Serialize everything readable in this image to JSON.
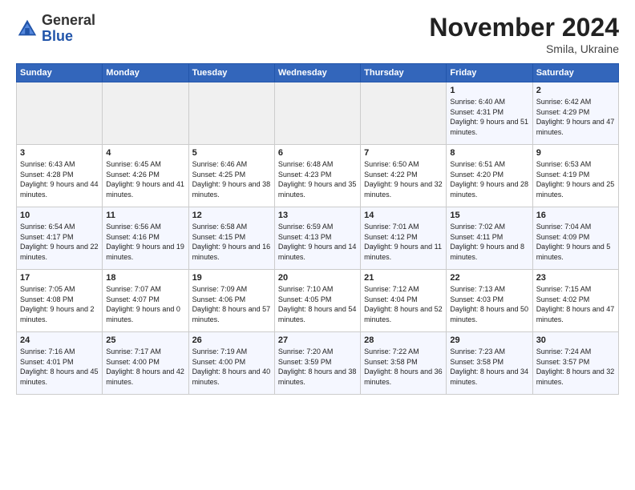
{
  "logo": {
    "general": "General",
    "blue": "Blue"
  },
  "header": {
    "title": "November 2024",
    "location": "Smila, Ukraine"
  },
  "days_of_week": [
    "Sunday",
    "Monday",
    "Tuesday",
    "Wednesday",
    "Thursday",
    "Friday",
    "Saturday"
  ],
  "weeks": [
    [
      {
        "day": "",
        "sunrise": "",
        "sunset": "",
        "daylight": ""
      },
      {
        "day": "",
        "sunrise": "",
        "sunset": "",
        "daylight": ""
      },
      {
        "day": "",
        "sunrise": "",
        "sunset": "",
        "daylight": ""
      },
      {
        "day": "",
        "sunrise": "",
        "sunset": "",
        "daylight": ""
      },
      {
        "day": "",
        "sunrise": "",
        "sunset": "",
        "daylight": ""
      },
      {
        "day": "1",
        "sunrise": "Sunrise: 6:40 AM",
        "sunset": "Sunset: 4:31 PM",
        "daylight": "Daylight: 9 hours and 51 minutes."
      },
      {
        "day": "2",
        "sunrise": "Sunrise: 6:42 AM",
        "sunset": "Sunset: 4:29 PM",
        "daylight": "Daylight: 9 hours and 47 minutes."
      }
    ],
    [
      {
        "day": "3",
        "sunrise": "Sunrise: 6:43 AM",
        "sunset": "Sunset: 4:28 PM",
        "daylight": "Daylight: 9 hours and 44 minutes."
      },
      {
        "day": "4",
        "sunrise": "Sunrise: 6:45 AM",
        "sunset": "Sunset: 4:26 PM",
        "daylight": "Daylight: 9 hours and 41 minutes."
      },
      {
        "day": "5",
        "sunrise": "Sunrise: 6:46 AM",
        "sunset": "Sunset: 4:25 PM",
        "daylight": "Daylight: 9 hours and 38 minutes."
      },
      {
        "day": "6",
        "sunrise": "Sunrise: 6:48 AM",
        "sunset": "Sunset: 4:23 PM",
        "daylight": "Daylight: 9 hours and 35 minutes."
      },
      {
        "day": "7",
        "sunrise": "Sunrise: 6:50 AM",
        "sunset": "Sunset: 4:22 PM",
        "daylight": "Daylight: 9 hours and 32 minutes."
      },
      {
        "day": "8",
        "sunrise": "Sunrise: 6:51 AM",
        "sunset": "Sunset: 4:20 PM",
        "daylight": "Daylight: 9 hours and 28 minutes."
      },
      {
        "day": "9",
        "sunrise": "Sunrise: 6:53 AM",
        "sunset": "Sunset: 4:19 PM",
        "daylight": "Daylight: 9 hours and 25 minutes."
      }
    ],
    [
      {
        "day": "10",
        "sunrise": "Sunrise: 6:54 AM",
        "sunset": "Sunset: 4:17 PM",
        "daylight": "Daylight: 9 hours and 22 minutes."
      },
      {
        "day": "11",
        "sunrise": "Sunrise: 6:56 AM",
        "sunset": "Sunset: 4:16 PM",
        "daylight": "Daylight: 9 hours and 19 minutes."
      },
      {
        "day": "12",
        "sunrise": "Sunrise: 6:58 AM",
        "sunset": "Sunset: 4:15 PM",
        "daylight": "Daylight: 9 hours and 16 minutes."
      },
      {
        "day": "13",
        "sunrise": "Sunrise: 6:59 AM",
        "sunset": "Sunset: 4:13 PM",
        "daylight": "Daylight: 9 hours and 14 minutes."
      },
      {
        "day": "14",
        "sunrise": "Sunrise: 7:01 AM",
        "sunset": "Sunset: 4:12 PM",
        "daylight": "Daylight: 9 hours and 11 minutes."
      },
      {
        "day": "15",
        "sunrise": "Sunrise: 7:02 AM",
        "sunset": "Sunset: 4:11 PM",
        "daylight": "Daylight: 9 hours and 8 minutes."
      },
      {
        "day": "16",
        "sunrise": "Sunrise: 7:04 AM",
        "sunset": "Sunset: 4:09 PM",
        "daylight": "Daylight: 9 hours and 5 minutes."
      }
    ],
    [
      {
        "day": "17",
        "sunrise": "Sunrise: 7:05 AM",
        "sunset": "Sunset: 4:08 PM",
        "daylight": "Daylight: 9 hours and 2 minutes."
      },
      {
        "day": "18",
        "sunrise": "Sunrise: 7:07 AM",
        "sunset": "Sunset: 4:07 PM",
        "daylight": "Daylight: 9 hours and 0 minutes."
      },
      {
        "day": "19",
        "sunrise": "Sunrise: 7:09 AM",
        "sunset": "Sunset: 4:06 PM",
        "daylight": "Daylight: 8 hours and 57 minutes."
      },
      {
        "day": "20",
        "sunrise": "Sunrise: 7:10 AM",
        "sunset": "Sunset: 4:05 PM",
        "daylight": "Daylight: 8 hours and 54 minutes."
      },
      {
        "day": "21",
        "sunrise": "Sunrise: 7:12 AM",
        "sunset": "Sunset: 4:04 PM",
        "daylight": "Daylight: 8 hours and 52 minutes."
      },
      {
        "day": "22",
        "sunrise": "Sunrise: 7:13 AM",
        "sunset": "Sunset: 4:03 PM",
        "daylight": "Daylight: 8 hours and 50 minutes."
      },
      {
        "day": "23",
        "sunrise": "Sunrise: 7:15 AM",
        "sunset": "Sunset: 4:02 PM",
        "daylight": "Daylight: 8 hours and 47 minutes."
      }
    ],
    [
      {
        "day": "24",
        "sunrise": "Sunrise: 7:16 AM",
        "sunset": "Sunset: 4:01 PM",
        "daylight": "Daylight: 8 hours and 45 minutes."
      },
      {
        "day": "25",
        "sunrise": "Sunrise: 7:17 AM",
        "sunset": "Sunset: 4:00 PM",
        "daylight": "Daylight: 8 hours and 42 minutes."
      },
      {
        "day": "26",
        "sunrise": "Sunrise: 7:19 AM",
        "sunset": "Sunset: 4:00 PM",
        "daylight": "Daylight: 8 hours and 40 minutes."
      },
      {
        "day": "27",
        "sunrise": "Sunrise: 7:20 AM",
        "sunset": "Sunset: 3:59 PM",
        "daylight": "Daylight: 8 hours and 38 minutes."
      },
      {
        "day": "28",
        "sunrise": "Sunrise: 7:22 AM",
        "sunset": "Sunset: 3:58 PM",
        "daylight": "Daylight: 8 hours and 36 minutes."
      },
      {
        "day": "29",
        "sunrise": "Sunrise: 7:23 AM",
        "sunset": "Sunset: 3:58 PM",
        "daylight": "Daylight: 8 hours and 34 minutes."
      },
      {
        "day": "30",
        "sunrise": "Sunrise: 7:24 AM",
        "sunset": "Sunset: 3:57 PM",
        "daylight": "Daylight: 8 hours and 32 minutes."
      }
    ]
  ]
}
